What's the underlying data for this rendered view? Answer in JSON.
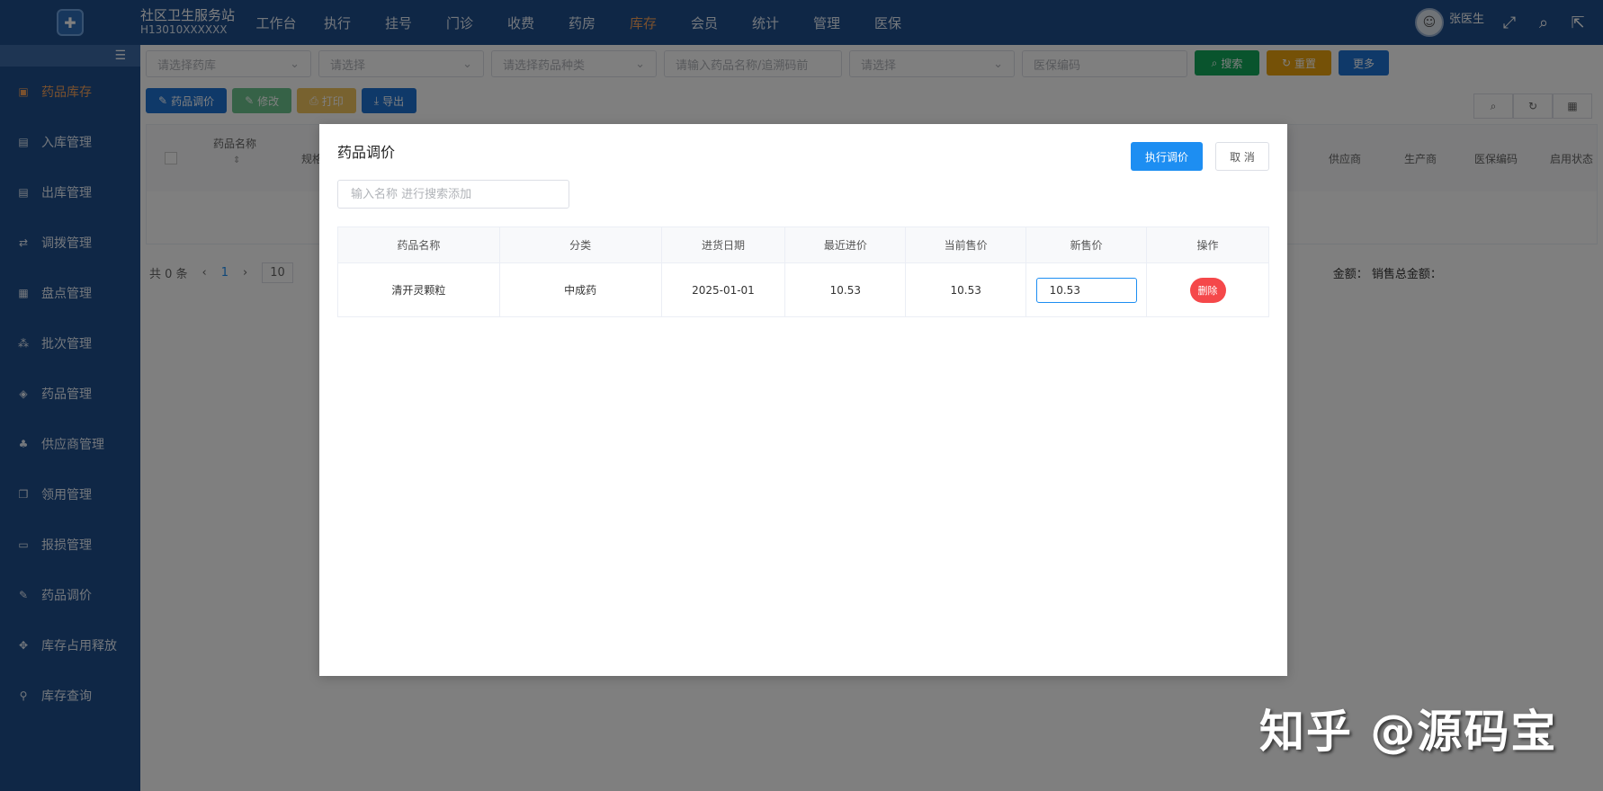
{
  "header": {
    "site_name": "社区卫生服务站",
    "site_code": "H13010XXXXXX",
    "nav": [
      "工作台",
      "执行",
      "挂号",
      "门诊",
      "收费",
      "药房",
      "库存",
      "会员",
      "统计",
      "管理",
      "医保"
    ],
    "active_nav": "库存",
    "user_name": "张医生"
  },
  "sidebar": {
    "items": [
      {
        "label": "药品库存",
        "icon": "pill-bottle-icon",
        "active": true
      },
      {
        "label": "入库管理",
        "icon": "inbox-in-icon"
      },
      {
        "label": "出库管理",
        "icon": "inbox-out-icon"
      },
      {
        "label": "调拨管理",
        "icon": "transfer-icon"
      },
      {
        "label": "盘点管理",
        "icon": "clipboard-icon"
      },
      {
        "label": "批次管理",
        "icon": "batch-icon"
      },
      {
        "label": "药品管理",
        "icon": "capsule-icon"
      },
      {
        "label": "供应商管理",
        "icon": "supplier-icon"
      },
      {
        "label": "领用管理",
        "icon": "receive-icon"
      },
      {
        "label": "报损管理",
        "icon": "damage-report-icon"
      },
      {
        "label": "药品调价",
        "icon": "edit-price-icon"
      },
      {
        "label": "库存占用释放",
        "icon": "release-icon"
      },
      {
        "label": "库存查询",
        "icon": "query-icon"
      }
    ]
  },
  "filters": {
    "pharmacy_placeholder": "请选择药库",
    "select_placeholder": "请选择",
    "drug_type_placeholder": "请选择药品种类",
    "drug_name_placeholder": "请输入药品名称/追溯码前",
    "select2_placeholder": "请选择",
    "insurance_code_placeholder": "医保编码",
    "search_label": "搜索",
    "reset_label": "重置",
    "more_label": "更多"
  },
  "actions": {
    "adjust_label": "药品调价",
    "edit_label": "修改",
    "print_label": "打印",
    "export_label": "导出"
  },
  "bg_table": {
    "col_name": "药品名称",
    "col_spec": "规格",
    "col_supplier": "供应商",
    "col_maker": "生产商",
    "col_insurance": "医保编码",
    "col_status": "启用状态",
    "total_count": "共 0 条",
    "page": "1",
    "page_size": "10",
    "amount_text": "金额：  销售总金额："
  },
  "dialog": {
    "title": "药品调价",
    "execute_label": "执行调价",
    "cancel_label": "取 消",
    "search_placeholder": "输入名称 进行搜索添加",
    "columns": [
      "药品名称",
      "分类",
      "进货日期",
      "最近进价",
      "当前售价",
      "新售价",
      "操作"
    ],
    "rows": [
      {
        "name": "清开灵颗粒",
        "category": "中成药",
        "purchase_date": "2025-01-01",
        "last_cost": "10.53",
        "current_price": "10.53",
        "new_price": "10.53",
        "delete_label": "删除"
      }
    ]
  },
  "watermark": "知乎 @源码宝"
}
